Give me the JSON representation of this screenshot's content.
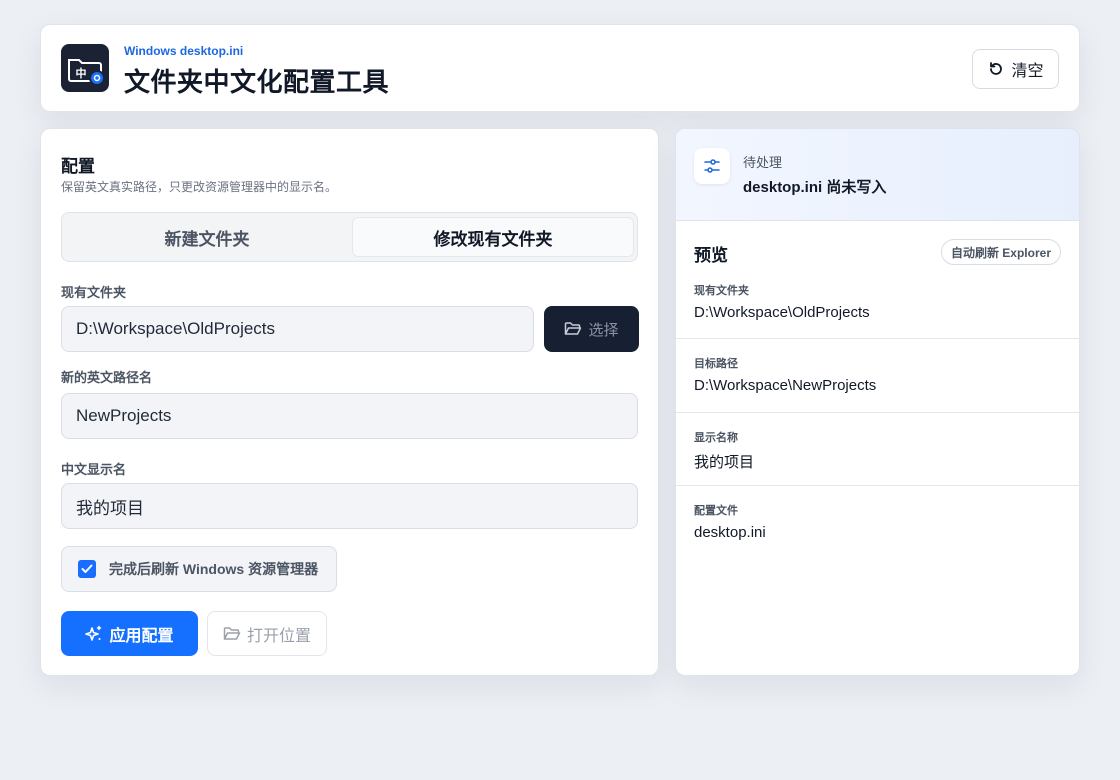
{
  "header": {
    "subtitle": "Windows desktop.ini",
    "title": "文件夹中文化配置工具",
    "logo_icon": "folder-zh-icon",
    "logo_text": "中",
    "clear_label": "清空",
    "clear_icon": "refresh-icon"
  },
  "config": {
    "title": "配置",
    "description": "保留英文真实路径，只更改资源管理器中的显示名。",
    "tabs": [
      {
        "label": "新建文件夹",
        "active": false
      },
      {
        "label": "修改现有文件夹",
        "active": true
      }
    ],
    "existing_folder": {
      "label": "现有文件夹",
      "value": "D:\\Workspace\\OldProjects"
    },
    "pick_button": {
      "label": "选择",
      "icon": "folder-open-icon"
    },
    "new_path": {
      "label": "新的英文路径名",
      "value": "NewProjects"
    },
    "display_name": {
      "label": "中文显示名",
      "value": "我的项目"
    },
    "refresh_checkbox": {
      "label": "完成后刷新 Windows 资源管理器",
      "checked": true
    },
    "apply_button": {
      "label": "应用配置",
      "icon": "sparkle-icon"
    },
    "open_button": {
      "label": "打开位置",
      "icon": "folder-open-icon"
    }
  },
  "preview": {
    "status": {
      "label": "待处理",
      "text": "desktop.ini 尚未写入",
      "icon": "sliders-icon"
    },
    "title": "预览",
    "badge": "自动刷新 Explorer",
    "rows": [
      {
        "key": "现有文件夹",
        "value": "D:\\Workspace\\OldProjects"
      },
      {
        "key": "目标路径",
        "value": "D:\\Workspace\\NewProjects"
      },
      {
        "key": "显示名称",
        "value": "我的项目"
      },
      {
        "key": "配置文件",
        "value": "desktop.ini"
      }
    ]
  },
  "colors": {
    "accent": "#1670ff",
    "dark": "#172033",
    "background": "#eceff4"
  }
}
